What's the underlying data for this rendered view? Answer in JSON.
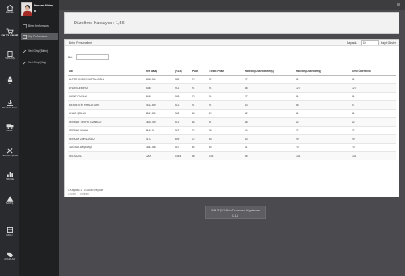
{
  "rail": [
    {
      "label": "Genel",
      "icon": "home-icon"
    },
    {
      "label": "ek.cllp.ne",
      "icon": "cart-icon"
    },
    {
      "label": "Sipariş",
      "icon": "clipboard-icon"
    },
    {
      "label": "IK",
      "icon": "user-icon"
    },
    {
      "label": "Pazarlama",
      "icon": "download-icon"
    },
    {
      "label": "İmal",
      "icon": "truck-icon"
    },
    {
      "label": "Teknik İşler",
      "icon": "tools-icon"
    },
    {
      "label": "Proje",
      "icon": "chart-icon"
    },
    {
      "label": "Satış",
      "icon": "warning-icon"
    },
    {
      "label": "Mali",
      "icon": "grid-icon"
    },
    {
      "label": "Ayarlar",
      "icon": "tag-icon"
    }
  ],
  "profile": {
    "name": "Kerem Aktaş"
  },
  "sub_items": [
    {
      "label": "Birim Performansı",
      "icon": "doc-icon",
      "active": false
    },
    {
      "label": "Kişi Performansı",
      "icon": "doc-icon",
      "active": true
    },
    {
      "label": "Veri Girişi (Birim)",
      "icon": "pencil-icon",
      "active": false
    },
    {
      "label": "Veri Girişi (Kişi)",
      "icon": "pencil-icon",
      "active": false
    }
  ],
  "coefficient_text": "Düzeltme Katsayısı : 1,56",
  "panel_title": "Birim Personelleri",
  "paging": {
    "prefix": "Sayfada",
    "value": "10",
    "suffix": "Kayıt Göster"
  },
  "search_label": "Bul:",
  "search_value": "",
  "table": {
    "headers": [
      "Adı",
      "Net Maaş",
      "(%15)",
      "Puan",
      "Toram Puan",
      "Hakediş(Düzeltilmemiş)",
      "Hakediş(Düzeltilmiş)",
      "Kesil Ödenecek"
    ],
    "rows": [
      [
        "ALPER EKİZCİ KURTULOĞLU",
        "2450.54",
        "389",
        "74",
        "37",
        "27",
        "31",
        "31"
      ],
      [
        "AYDIN DEMİRCİ",
        "6345",
        "912",
        "91",
        "91",
        "88",
        "127",
        "127"
      ],
      [
        "GÜNEYTUNLU",
        "2410",
        "303",
        "74",
        "31",
        "27",
        "31",
        "31"
      ],
      [
        "HAYRETTİN PARLATÜRK",
        "4412.89",
        "512",
        "91",
        "91",
        "53",
        "96",
        "97"
      ],
      [
        "ONUR ÇOLAK",
        "2547.80",
        "302",
        "83",
        "29",
        "32",
        "41",
        "41"
      ],
      [
        "SERDAR TEVFİK GÜNAGÖ",
        "3815.49",
        "572",
        "84",
        "57",
        "48",
        "62",
        "62"
      ],
      [
        "SERHAN KINALI",
        "2141.3",
        "307",
        "74",
        "33",
        "24",
        "27",
        "27"
      ],
      [
        "SERKAN ZORLOĞLU",
        "4172",
        "629",
        "12",
        "63",
        "33",
        "29",
        "29"
      ],
      [
        "TUĞRUL AKŞEMŞİ",
        "3543.58",
        "547",
        "82",
        "65",
        "51",
        "73",
        "73"
      ],
      [
        "VELİ ÖZEL",
        "7200",
        "1034",
        "80",
        "103",
        "86",
        "131",
        "131"
      ]
    ]
  },
  "info_text": "1 Kayıttan 1 - 10 Arası Kayıtlar",
  "pager": [
    "Önceki",
    "Sonraki"
  ],
  "toast": {
    "line1": "2014 © ÇYS Birim Performans Uygulaması",
    "line2": "1.1.1"
  }
}
